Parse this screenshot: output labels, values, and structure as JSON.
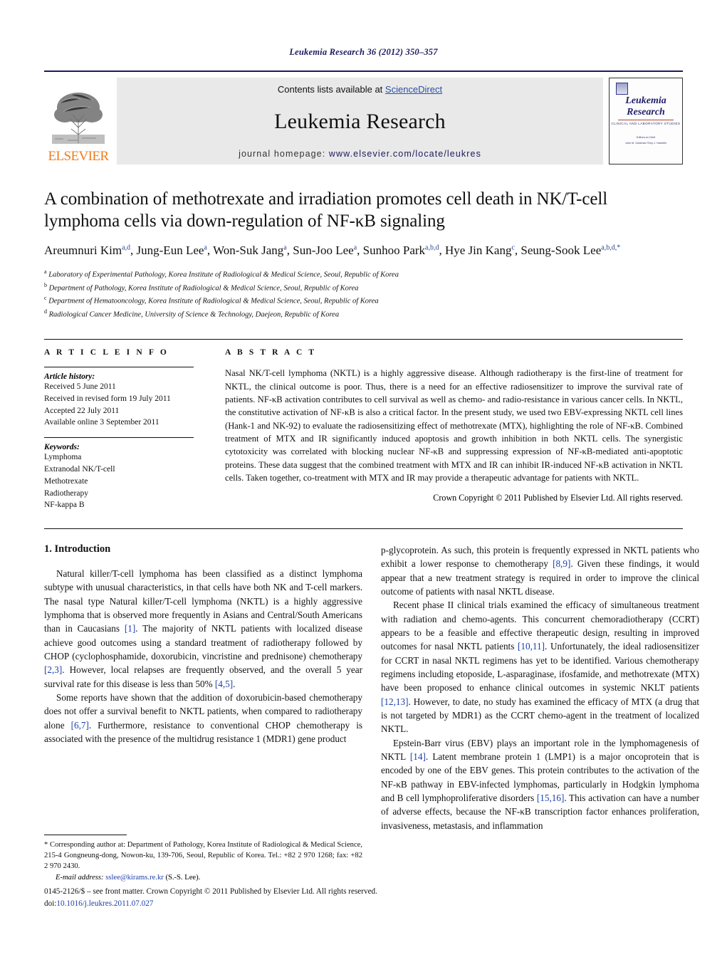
{
  "running_head": "Leukemia Research 36 (2012) 350–357",
  "masthead": {
    "publisher_name": "ELSEVIER",
    "contents_prefix": "Contents lists available at ",
    "contents_link": "ScienceDirect",
    "journal_title": "Leukemia Research",
    "homepage_label": "journal homepage:",
    "homepage_url": "www.elsevier.com/locate/leukres",
    "cover": {
      "title_line1": "Leukemia",
      "title_line2": "Research",
      "subtitle": "CLINICAL AND LABORATORY STUDIES",
      "meta_line1": "Editors-in-Chief",
      "meta_line2": "John M. Goldman    Terry J. Hamblin"
    }
  },
  "article": {
    "title": "A combination of methotrexate and irradiation promotes cell death in NK/T-cell lymphoma cells via down-regulation of NF-κB signaling",
    "authors_html": "Areumnuri Kim<sup>a,d</sup>, Jung-Eun Lee<sup>a</sup>, Won-Suk Jang<sup>a</sup>, Sun-Joo Lee<sup>a</sup>, Sunhoo Park<sup>a,b,d</sup>, Hye Jin Kang<sup>c</sup>, Seung-Sook Lee<sup>a,b,d,</sup><sup>*</sup>",
    "affiliations": [
      {
        "marker": "a",
        "text": "Laboratory of Experimental Pathology, Korea Institute of Radiological & Medical Science, Seoul, Republic of Korea"
      },
      {
        "marker": "b",
        "text": "Department of Pathology, Korea Institute of Radiological & Medical Science, Seoul, Republic of Korea"
      },
      {
        "marker": "c",
        "text": "Department of Hematooncology, Korea Institute of Radiological & Medical Science, Seoul, Republic of Korea"
      },
      {
        "marker": "d",
        "text": "Radiological Cancer Medicine, University of Science & Technology, Daejeon, Republic of Korea"
      }
    ]
  },
  "article_info": {
    "heading": "A R T I C L E   I N F O",
    "history_label": "Article history:",
    "history": [
      "Received 5 June 2011",
      "Received in revised form 19 July 2011",
      "Accepted 22 July 2011",
      "Available online 3 September 2011"
    ],
    "keywords_label": "Keywords:",
    "keywords": [
      "Lymphoma",
      "Extranodal NK/T-cell",
      "Methotrexate",
      "Radiotherapy",
      "NF-kappa B"
    ]
  },
  "abstract": {
    "heading": "A B S T R A C T",
    "text": "Nasal NK/T-cell lymphoma (NKTL) is a highly aggressive disease. Although radiotherapy is the first-line of treatment for NKTL, the clinical outcome is poor. Thus, there is a need for an effective radiosensitizer to improve the survival rate of patients. NF-κB activation contributes to cell survival as well as chemo- and radio-resistance in various cancer cells. In NKTL, the constitutive activation of NF-κB is also a critical factor. In the present study, we used two EBV-expressing NKTL cell lines (Hank-1 and NK-92) to evaluate the radiosensitizing effect of methotrexate (MTX), highlighting the role of NF-κB. Combined treatment of MTX and IR significantly induced apoptosis and growth inhibition in both NKTL cells. The synergistic cytotoxicity was correlated with blocking nuclear NF-κB and suppressing expression of NF-κB-mediated anti-apoptotic proteins. These data suggest that the combined treatment with MTX and IR can inhibit IR-induced NF-κB activation in NKTL cells. Taken together, co-treatment with MTX and IR may provide a therapeutic advantage for patients with NKTL.",
    "copyright": "Crown Copyright © 2011 Published by Elsevier Ltd. All rights reserved."
  },
  "body": {
    "section_number_title": "1.  Introduction",
    "left_paragraphs": [
      "Natural killer/T-cell lymphoma has been classified as a distinct lymphoma subtype with unusual characteristics, in that cells have both NK and T-cell markers. The nasal type Natural killer/T-cell lymphoma (NKTL) is a highly aggressive lymphoma that is observed more frequently in Asians and Central/South Americans than in Caucasians [1]. The majority of NKTL patients with localized disease achieve good outcomes using a standard treatment of radiotherapy followed by CHOP (cyclophosphamide, doxorubicin, vincristine and prednisone) chemotherapy [2,3]. However, local relapses are frequently observed, and the overall 5 year survival rate for this disease is less than 50% [4,5].",
      "Some reports have shown that the addition of doxorubicin-based chemotherapy does not offer a survival benefit to NKTL patients, when compared to radiotherapy alone [6,7]. Furthermore, resistance to conventional CHOP chemotherapy is associated with the presence of the multidrug resistance 1 (MDR1) gene product"
    ],
    "right_paragraphs": [
      "p-glycoprotein. As such, this protein is frequently expressed in NKTL patients who exhibit a lower response to chemotherapy [8,9]. Given these findings, it would appear that a new treatment strategy is required in order to improve the clinical outcome of patients with nasal NKTL disease.",
      "Recent phase II clinical trials examined the efficacy of simultaneous treatment with radiation and chemo-agents. This concurrent chemoradiotherapy (CCRT) appears to be a feasible and effective therapeutic design, resulting in improved outcomes for nasal NKTL patients [10,11]. Unfortunately, the ideal radiosensitizer for CCRT in nasal NKTL regimens has yet to be identified. Various chemotherapy regimens including etoposide, L-asparaginase, ifosfamide, and methotrexate (MTX) have been proposed to enhance clinical outcomes in systemic NKLT patients [12,13]. However, to date, no study has examined the efficacy of MTX (a drug that is not targeted by MDR1) as the CCRT chemo-agent in the treatment of localized NKTL.",
      "Epstein-Barr virus (EBV) plays an important role in the lymphomagenesis of NKTL [14]. Latent membrane protein 1 (LMP1) is a major oncoprotein that is encoded by one of the EBV genes. This protein contributes to the activation of the NF-κB pathway in EBV-infected lymphomas, particularly in Hodgkin lymphoma and B cell lymphoproliferative disorders [15,16]. This activation can have a number of adverse effects, because the NF-κB transcription factor enhances proliferation, invasiveness, metastasis, and inflammation"
    ]
  },
  "footnote": {
    "marker": "*",
    "corresponding": "Corresponding author at: Department of Pathology, Korea Institute of Radiological & Medical Science, 215-4 Gongneung-dong, Nowon-ku, 139-706, Seoul, Republic of Korea. Tel.: +82 2 970 1268; fax: +82 2 970 2430.",
    "email_label": "E-mail address:",
    "email": "sslee@kirams.re.kr",
    "email_suffix": "(S.-S. Lee)."
  },
  "imprint": {
    "line1": "0145-2126/$ – see front matter. Crown Copyright © 2011 Published by Elsevier Ltd. All rights reserved.",
    "doi_label": "doi:",
    "doi": "10.1016/j.leukres.2011.07.027"
  },
  "colors": {
    "running_head": "#1a1a5e",
    "elsevier_orange": "#f07c18",
    "link_blue": "#1c3faa",
    "sciencedirect_blue": "#2a4fa2",
    "banner_gray": "#e9e9e9"
  }
}
